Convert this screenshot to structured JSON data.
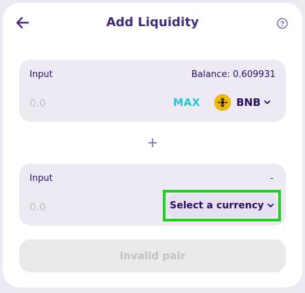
{
  "header": {
    "title": "Add Liquidity",
    "back_icon": "arrow-left-icon",
    "help_icon": "help-circle-icon"
  },
  "input_a": {
    "label": "Input",
    "balance": "Balance: 0.609931",
    "placeholder": "0.0",
    "max_label": "MAX",
    "token": "BNB",
    "token_icon": "bnb-logo-icon"
  },
  "plus": "+",
  "input_b": {
    "label": "Input",
    "balance": "-",
    "placeholder": "0.0",
    "select_label": "Select a currency"
  },
  "action": {
    "label": "Invalid pair"
  },
  "colors": {
    "accent": "#1fc7d4",
    "title": "#452a7a",
    "text": "#280d5f",
    "panel": "#eeeaf4",
    "highlight": "#1fd31f",
    "bnb": "#f0b90b"
  }
}
